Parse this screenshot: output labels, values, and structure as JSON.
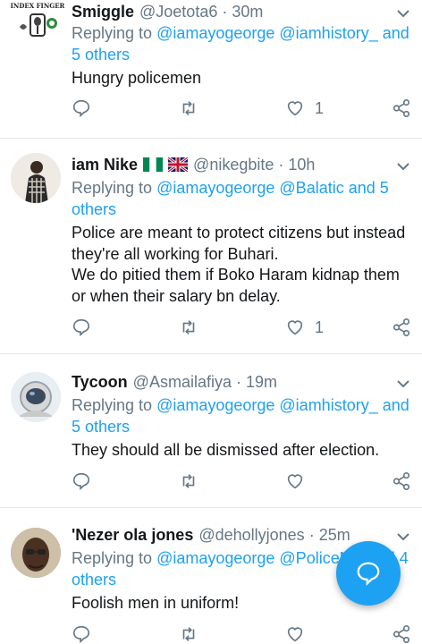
{
  "tweets": [
    {
      "name": "Smiggle",
      "handle": "@Joetota6",
      "sep": "·",
      "time": "30m",
      "replying_prefix": "Replying to ",
      "replying_links": "@iamayogeorge @iamhistory_ and 5 others",
      "text": "Hungry policemen",
      "likes": "1",
      "avatar_text": "INDEX FINGER"
    },
    {
      "name": "iam Nike",
      "handle": "@nikegbite",
      "sep": "·",
      "time": "10h",
      "replying_prefix": "Replying to ",
      "replying_links": "@iamayogeorge @Balatic and 5 others",
      "text": "Police are meant to protect citizens but instead they're all working for Buhari.\nWe do pitied them if Boko Haram kidnap them or when their salary bn delay.",
      "likes": "1"
    },
    {
      "name": "Tycoon",
      "handle": "@Asmailafiya",
      "sep": "·",
      "time": "19m",
      "replying_prefix": "Replying to ",
      "replying_links": "@iamayogeorge @iamhistory_ and 5 others",
      "text": "They should all be dismissed after election.",
      "likes": ""
    },
    {
      "name": "'Nezer ola jones",
      "handle": "@dehollyjones",
      "sep": "·",
      "time": "25m",
      "replying_prefix": "Replying to ",
      "replying_links": "@iamayogeorge @PoliceNG and 4 others",
      "text": "Foolish men in uniform!",
      "likes": ""
    }
  ],
  "colors": {
    "link": "#1da1f2",
    "muted": "#657786",
    "text": "#14171a",
    "fab": "#1da1f2"
  },
  "icons": {
    "reply": "reply-icon",
    "retweet": "retweet-icon",
    "like": "heart-icon",
    "share": "share-icon",
    "more": "chevron-down-icon",
    "compose": "compose-reply-icon"
  }
}
